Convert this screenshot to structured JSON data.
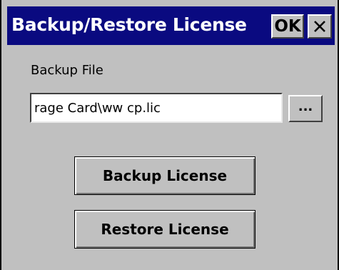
{
  "window": {
    "title": "Backup/Restore License",
    "ok_label": "OK",
    "close_icon": "close-icon"
  },
  "form": {
    "file_label": "Backup File",
    "file_value": "rage Card\\ww cp.lic",
    "browse_label": "..."
  },
  "actions": {
    "backup_label": "Backup License",
    "restore_label": "Restore License"
  },
  "colors": {
    "titlebar": "#0a0a80",
    "face": "#c0c0c0"
  }
}
